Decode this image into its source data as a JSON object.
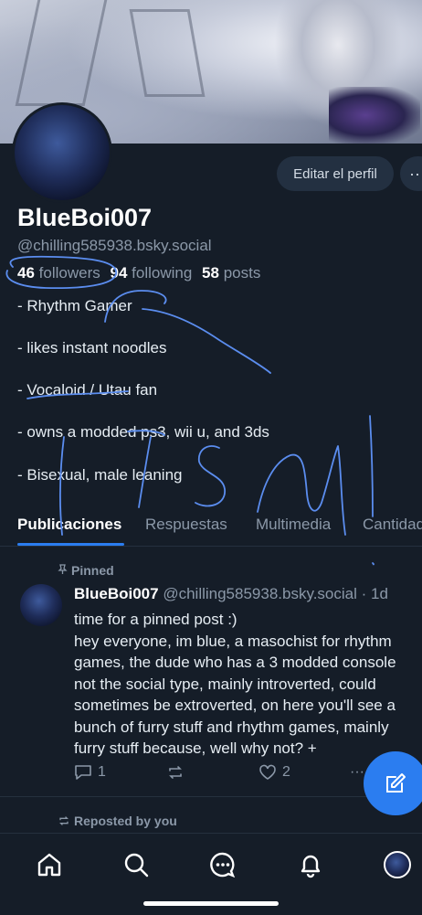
{
  "profile": {
    "display_name": "BlueBoi007",
    "handle": "@chilling585938.bsky.social",
    "edit_button": "Editar el perfil",
    "more_button": "···",
    "stats": {
      "followers_count": "46",
      "followers_label": "followers",
      "following_count": "94",
      "following_label": "following",
      "posts_count": "58",
      "posts_label": "posts"
    },
    "bio": [
      "- Rhythm Gamer",
      "- likes instant noodles",
      "- Vocaloid / Utau fan",
      "- owns a modded ps3, wii u, and 3ds",
      "- Bisexual, male leaning"
    ]
  },
  "tabs": [
    "Publicaciones",
    "Respuestas",
    "Multimedia",
    "Cantidad"
  ],
  "active_tab": "Publicaciones",
  "post": {
    "pinned_label": "Pinned",
    "author_name": "BlueBoi007",
    "author_handle": "@chilling585938.bsky.social",
    "time": "· 1d",
    "lines": [
      "time for a pinned post :)",
      "hey everyone, im blue, a masochist for rhythm games, the dude who has a 3 modded console not the social type, mainly introverted, could sometimes be extroverted, on here you'll see a bunch of furry stuff and rhythm games, mainly furry stuff because, well why not? +"
    ],
    "reply_count": "1",
    "like_count": "2",
    "more_label": "···"
  },
  "reposted_label": "Reposted by you",
  "icons": {
    "home": "home-icon",
    "search": "search-icon",
    "chat": "chat-icon",
    "notifications": "bell-icon",
    "compose": "pencil-icon"
  },
  "colors": {
    "background": "#151d28",
    "accent": "#2b7df0",
    "muted": "#8b98a8",
    "scribble": "#5b8def"
  }
}
